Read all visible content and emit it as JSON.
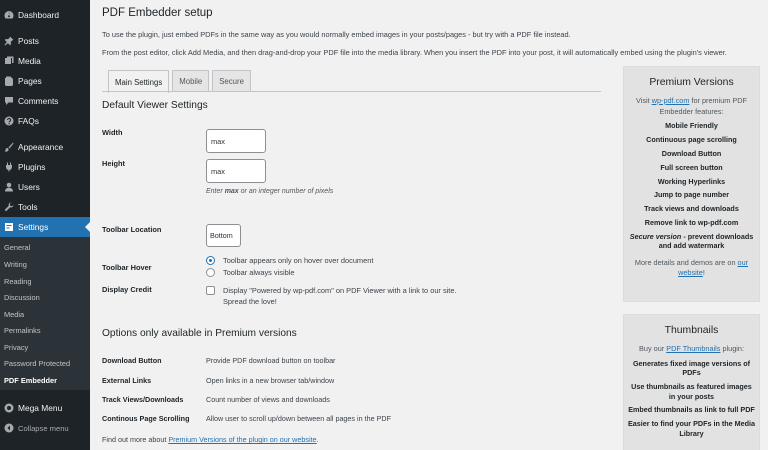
{
  "sidebar": {
    "top_items": [
      {
        "label": "Dashboard",
        "icon": "dashboard-icon"
      },
      {
        "label": "Posts",
        "icon": "pin-icon"
      },
      {
        "label": "Media",
        "icon": "media-icon"
      },
      {
        "label": "Pages",
        "icon": "page-icon"
      },
      {
        "label": "Comments",
        "icon": "comment-icon"
      },
      {
        "label": "FAQs",
        "icon": "question-icon"
      },
      {
        "label": "Appearance",
        "icon": "brush-icon"
      },
      {
        "label": "Plugins",
        "icon": "plug-icon"
      },
      {
        "label": "Users",
        "icon": "user-icon"
      },
      {
        "label": "Tools",
        "icon": "wrench-icon"
      },
      {
        "label": "Settings",
        "icon": "settings-icon"
      }
    ],
    "submenu": [
      "General",
      "Writing",
      "Reading",
      "Discussion",
      "Media",
      "Permalinks",
      "Privacy",
      "Password Protected",
      "PDF Embedder"
    ],
    "mega_menu": "Mega Menu",
    "collapse": "Collapse menu",
    "colors": {
      "bg": "#1d2327",
      "active": "#2271b1",
      "submenu_bg": "#2c3338"
    }
  },
  "main": {
    "title": "PDF Embedder setup",
    "intro1": "To use the plugin, just embed PDFs in the same way as you would normally embed images in your posts/pages - but try with a PDF file instead.",
    "intro2": "From the post editor, click Add Media, and then drag-and-drop your PDF file into the media library. When you insert the PDF into your post, it will automatically embed using the plugin's viewer.",
    "tabs": [
      "Main Settings",
      "Mobile",
      "Secure"
    ],
    "default_heading": "Default Viewer Settings",
    "width_label": "Width",
    "width_value": "max",
    "height_label": "Height",
    "height_value": "max",
    "hint_pre": "Enter ",
    "hint_bold": "max",
    "hint_post": " or an integer number of pixels",
    "toolbar_location_label": "Toolbar Location",
    "toolbar_location_value": "Bottom",
    "toolbar_hover_label": "Toolbar Hover",
    "hover_option1": "Toolbar appears only on hover over document",
    "hover_option2": "Toolbar always visible",
    "display_credit_label": "Display Credit",
    "display_credit_text": "Display \"Powered by wp-pdf.com\" on PDF Viewer with a link to our site. Spread the love!",
    "premium_heading": "Options only available in Premium versions",
    "premium_options": [
      {
        "label": "Download Button",
        "desc": "Provide PDF download button on toolbar"
      },
      {
        "label": "External Links",
        "desc": "Open links in a new browser tab/window"
      },
      {
        "label": "Track Views/Downloads",
        "desc": "Count number of views and downloads"
      },
      {
        "label": "Continous Page Scrolling",
        "desc": "Allow user to scroll up/down between all pages in the PDF"
      }
    ],
    "findout_pre": "Find out more about ",
    "findout_link": "Premium Versions of the plugin on our website",
    "findout_post": "."
  },
  "premium_box": {
    "title": "Premium Versions",
    "visit_pre": "Visit ",
    "visit_link": "wp-pdf.com",
    "visit_post": " for premium PDF Embedder features:",
    "features": [
      "Mobile Friendly",
      "Continuous page scrolling",
      "Download Button",
      "Full screen button",
      "Working Hyperlinks",
      "Jump to page number",
      "Track views and downloads",
      "Remove link to wp-pdf.com"
    ],
    "secure_italic": "Secure version",
    "secure_rest": " - prevent downloads and add watermark",
    "more_pre": "More details and demos are on ",
    "more_link": "our website",
    "more_post": "!"
  },
  "thumb_box": {
    "title": "Thumbnails",
    "buy_pre": "Buy our ",
    "buy_link": "PDF Thumbnails",
    "buy_post": " plugin:",
    "features": [
      "Generates fixed image versions of PDFs",
      "Use thumbnails as featured images in your posts",
      "Embed thumbnails as link to full PDF",
      "Easier to find your PDFs in the Media Library"
    ]
  }
}
